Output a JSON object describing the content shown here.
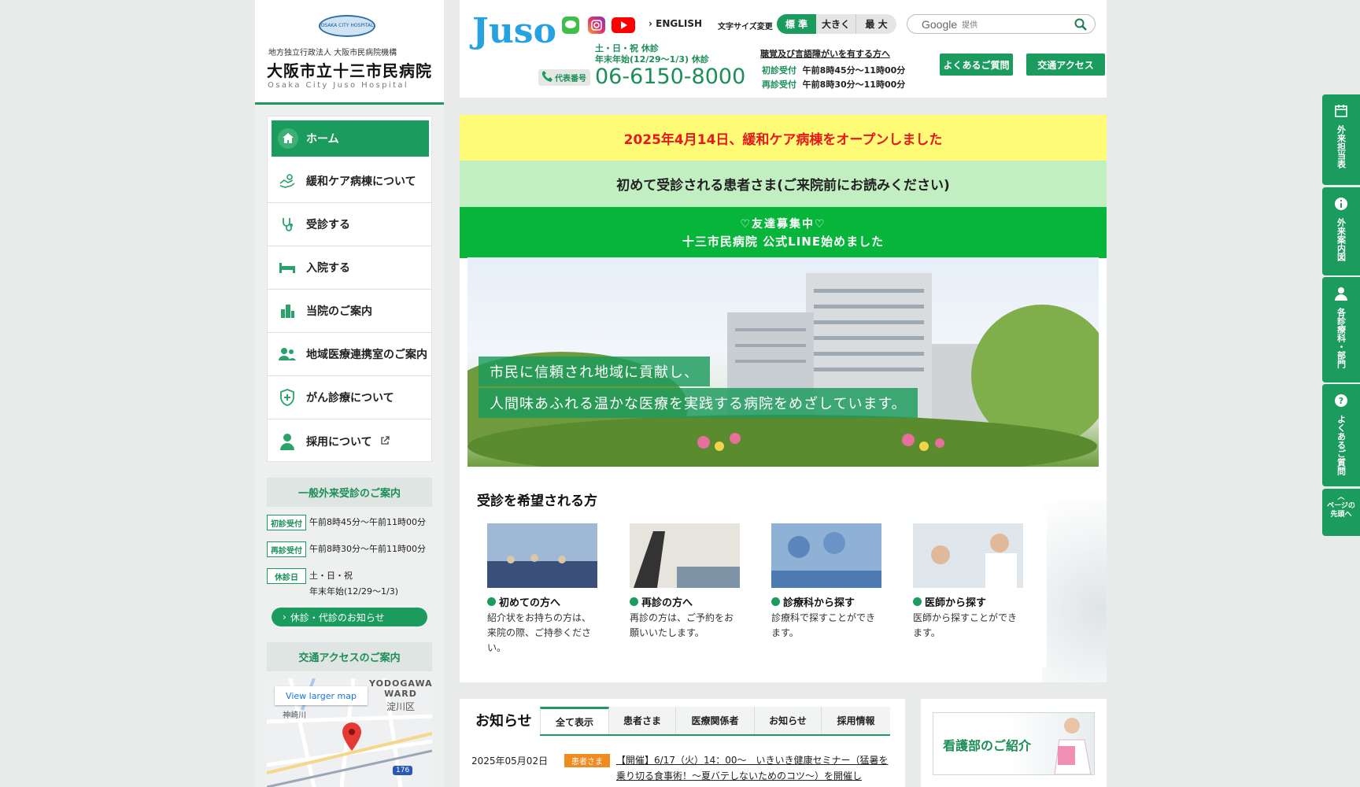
{
  "logo": {
    "mark_text": "OSAKA CITY HOSPITAL",
    "subtitle": "地方独立行政法人 大阪市民病院機構",
    "name": "大阪市立十三市民病院",
    "name_en": "Osaka City Juso Hospital"
  },
  "nav": {
    "items": [
      {
        "label": "ホーム",
        "icon": "home-icon"
      },
      {
        "label": "緩和ケア病棟について",
        "icon": "care-hands-icon"
      },
      {
        "label": "受診する",
        "icon": "stethoscope-icon"
      },
      {
        "label": "入院する",
        "icon": "bed-icon"
      },
      {
        "label": "当院のご案内",
        "icon": "building-icon"
      },
      {
        "label": "地域医療連携室のご案内",
        "icon": "people-icon"
      },
      {
        "label": "がん診療について",
        "icon": "shield-plus-icon"
      },
      {
        "label": "採用について",
        "icon": "doctor-icon"
      }
    ],
    "external_icon": "external-link-icon"
  },
  "outpatient": {
    "title": "一般外来受診のご案内",
    "first_label": "初診受付",
    "first_time": "午前8時45分〜午前11時00分",
    "return_label": "再診受付",
    "return_time": "午前8時30分〜午前11時00分",
    "closed_label": "休診日",
    "closed_1": "土・日・祝",
    "closed_2": "年末年始(12/29～1/3)",
    "closure_notice": "休診・代診のお知らせ"
  },
  "access": {
    "title": "交通アクセスのご案内",
    "map_link": "View larger map",
    "map_ward_en": "YODOGAWA WARD",
    "map_ward_jp": "淀川区",
    "map_place": "神崎川",
    "map_route": "176"
  },
  "header": {
    "logo_text": "Juso",
    "english_link": "ENGLISH",
    "font_size_label": "文字サイズ変更",
    "font_sizes": [
      "標 準",
      "大きく",
      "最 大"
    ],
    "search_brand": "Google",
    "search_placeholder": "提供",
    "closed_line1": "土・日・祝 休診",
    "closed_line2": "年末年始(12/29～1/3) 休診",
    "phone_label": "代表番号",
    "phone": "06-6150-8000",
    "hearing_link": "聴覚及び言語障がいを有する方へ",
    "first_label": "初診受付",
    "first_time": "午前8時45分～11時00分",
    "return_label": "再診受付",
    "return_time": "午前8時30分～11時00分",
    "faq_button": "よくあるご質問",
    "access_button": "交通アクセス"
  },
  "banners": {
    "palliative": "2025年4月14日、緩和ケア病棟をオープンしました",
    "first_visit": "初めて受診される患者さま(ご来院前にお読みください)",
    "line_1": "♡友達募集中♡",
    "line_2": "十三市民病院 公式LINE始めました"
  },
  "hero": {
    "line1": "市民に信頼され地域に貢献し、",
    "line2": "人間味あふれる温かな医療を実践する病院をめざしています。"
  },
  "consult": {
    "title": "受診を希望される方",
    "cards": [
      {
        "title": "初めての方へ",
        "desc": "紹介状をお持ちの方は、来院の際、ご持参ください。"
      },
      {
        "title": "再診の方へ",
        "desc": "再診の方は、ご予約をお願いいたします。"
      },
      {
        "title": "診療科から探す",
        "desc": "診療科で探すことができます。"
      },
      {
        "title": "医師から探す",
        "desc": "医師から探すことができます。"
      }
    ]
  },
  "news": {
    "title": "お知らせ",
    "tabs": [
      "全て表示",
      "患者さま",
      "医療関係者",
      "お知らせ",
      "採用情報"
    ],
    "items": [
      {
        "date": "2025年05月02日",
        "tag": "患者さま",
        "text": "【開催】6/17（火）14：00～　いきいき健康セミナー（猛暑を乗り切る食事術！～夏バテしないためのコツ～）を開催し"
      }
    ]
  },
  "nursing": {
    "label": "看護部のご紹介"
  },
  "right_tabs": [
    "外来担当表",
    "外来案内図",
    "各診療科・部門",
    "よくあるご質問",
    "ページの先頭へ"
  ],
  "colors": {
    "brand_green": "#1b9b5d",
    "light_green": "#c2efc2",
    "yellow": "#fffb77",
    "alert_red": "#e8191e",
    "tag_orange": "#ef8b1f"
  }
}
